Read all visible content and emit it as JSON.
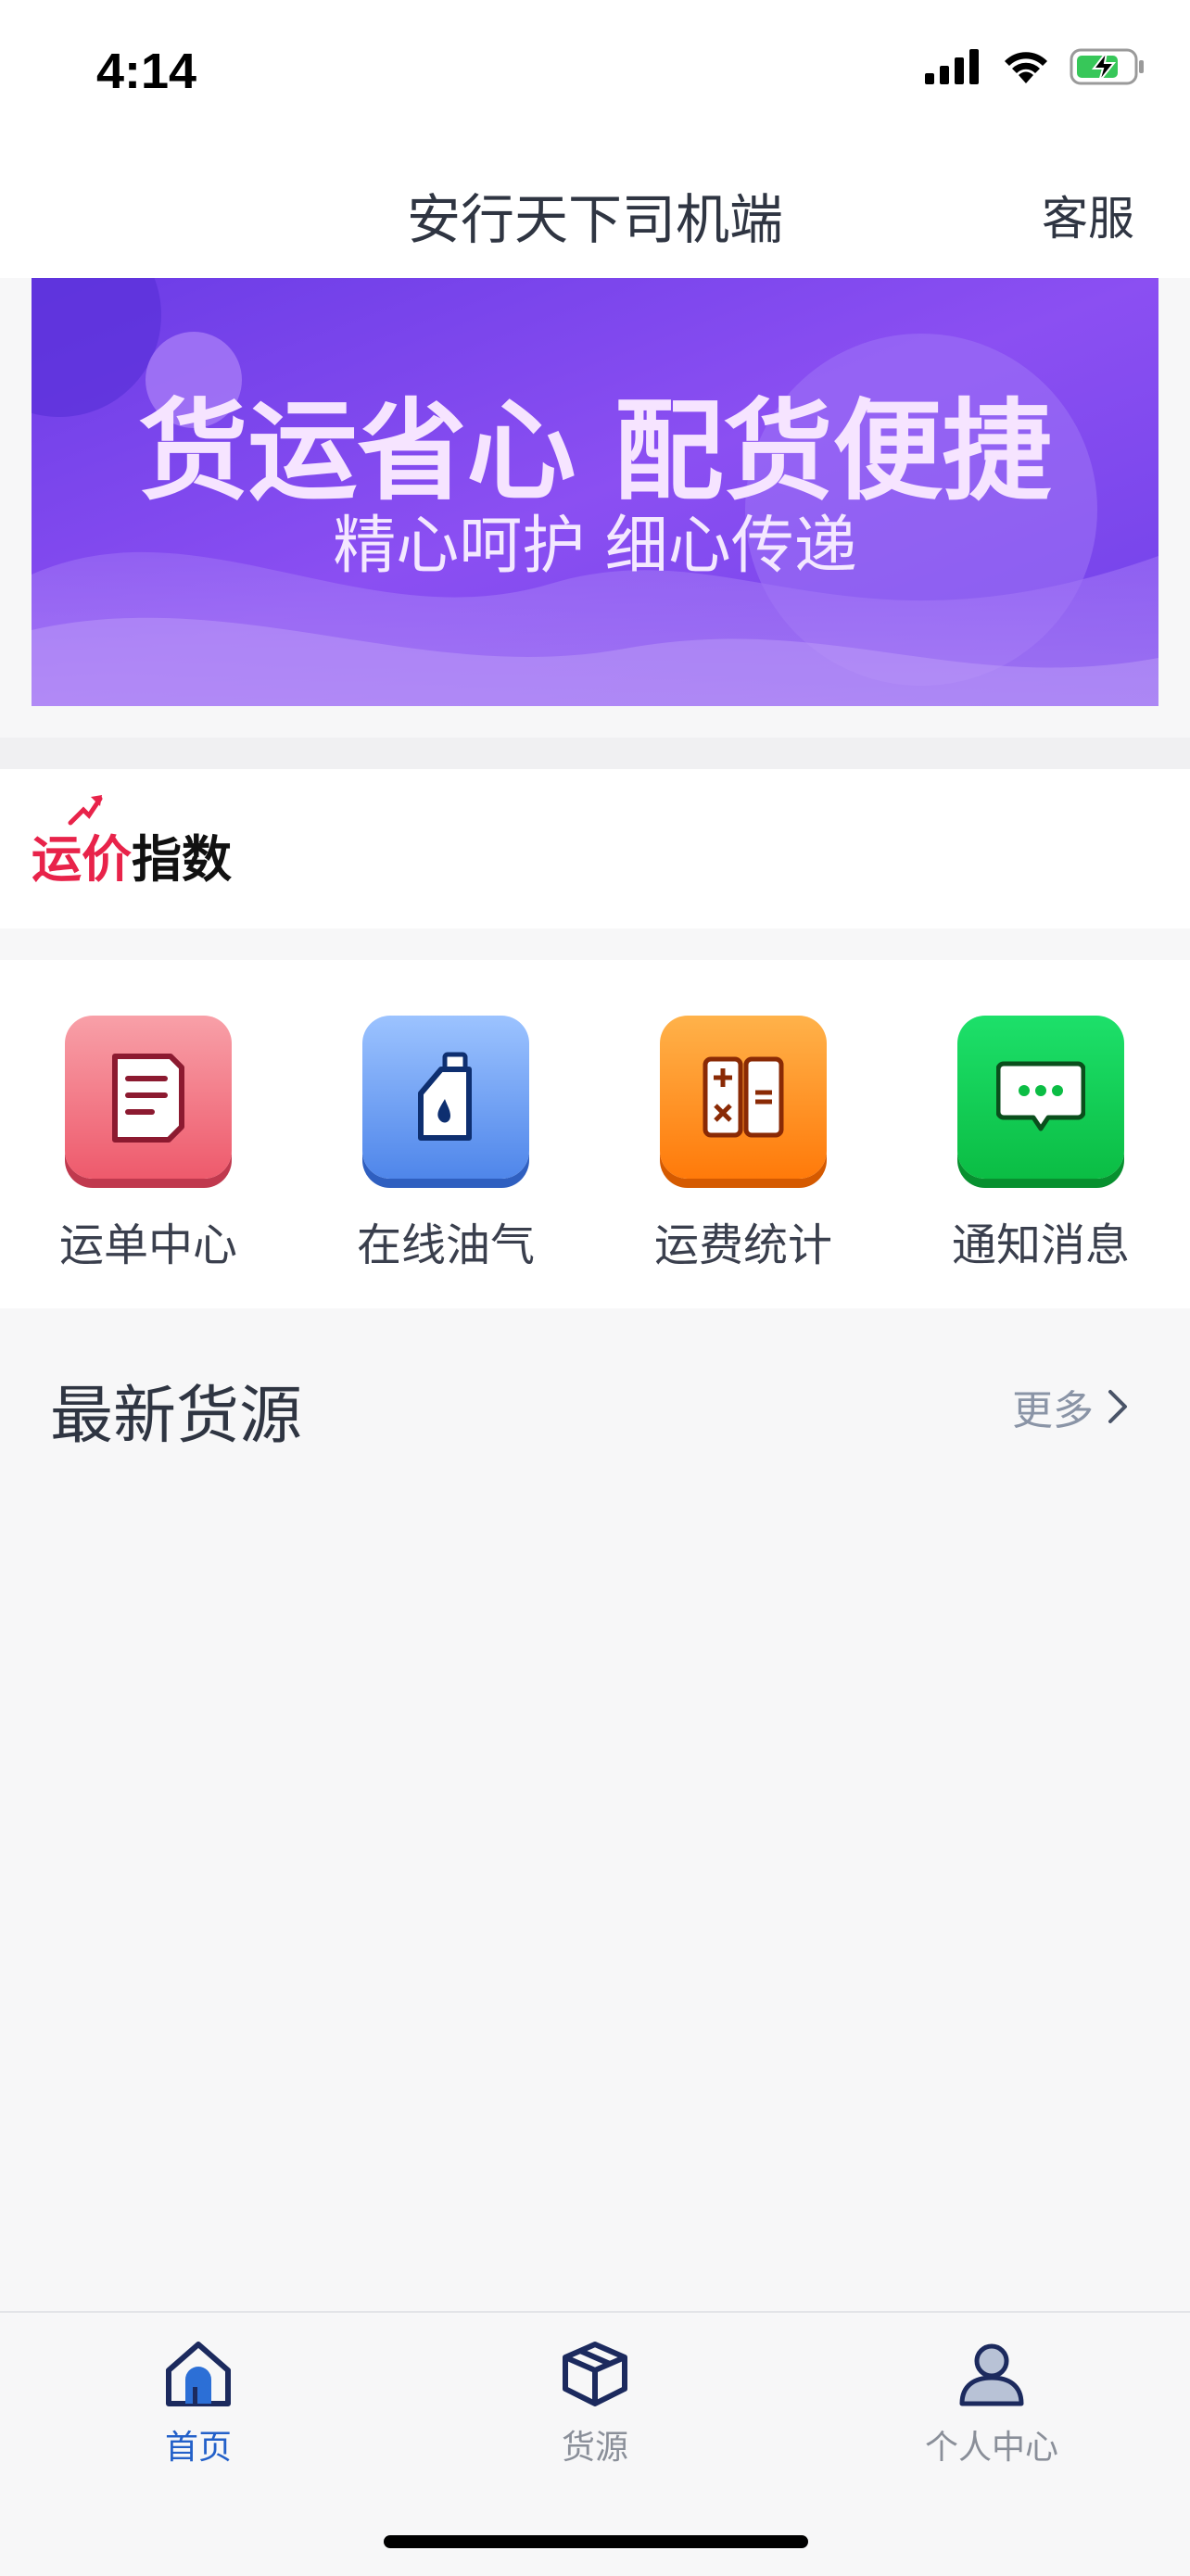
{
  "status_bar": {
    "time": "4:14"
  },
  "nav": {
    "title": "安行天下司机端",
    "service": "客服"
  },
  "banner": {
    "headline": "货运省心 配货便捷",
    "subline": "精心呵护 细心传递"
  },
  "freight_index": {
    "red_text": "运价",
    "black_text": "指数"
  },
  "quick_actions": [
    {
      "label": "运单中心",
      "icon": "document-icon"
    },
    {
      "label": "在线油气",
      "icon": "oil-bottle-icon"
    },
    {
      "label": "运费统计",
      "icon": "calculator-icon"
    },
    {
      "label": "通知消息",
      "icon": "message-icon"
    }
  ],
  "latest_cargo": {
    "title": "最新货源",
    "more": "更多"
  },
  "tabs": [
    {
      "label": "首页",
      "icon": "home-icon",
      "active": true
    },
    {
      "label": "货源",
      "icon": "box-icon",
      "active": false
    },
    {
      "label": "个人中心",
      "icon": "person-icon",
      "active": false
    }
  ],
  "colors": {
    "accent": "#2360c9",
    "index_red": "#e8234a",
    "banner": "#7a45ee"
  }
}
